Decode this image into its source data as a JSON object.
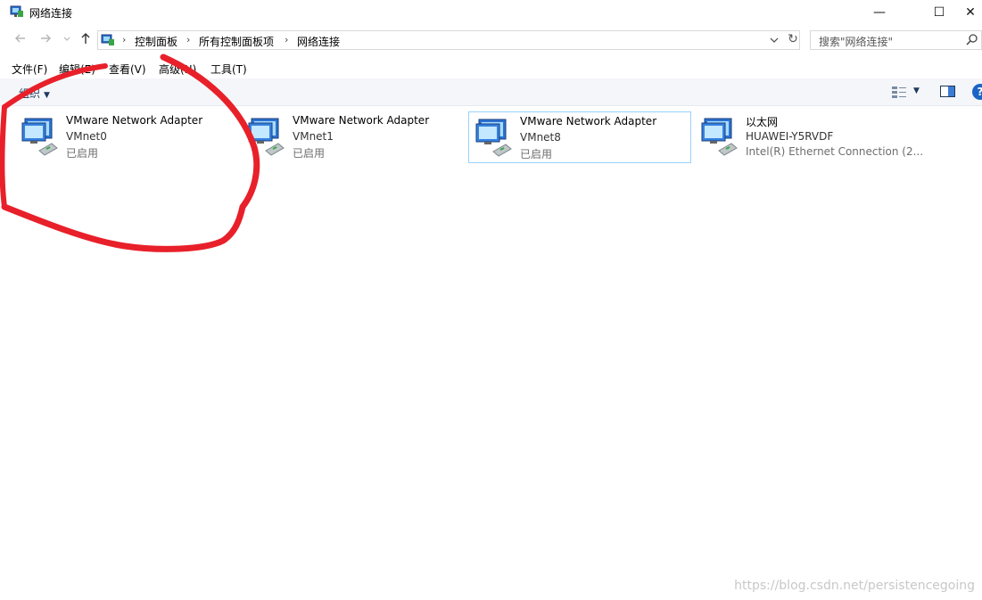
{
  "window": {
    "title": "网络连接",
    "controls": {
      "minimize": "—",
      "maximize": "☐",
      "close": "✕"
    }
  },
  "navigation": {
    "back_icon": "arrow-left-icon",
    "forward_icon": "arrow-right-icon",
    "recent_icon": "chevron-down-icon",
    "up_icon": "arrow-up-icon",
    "breadcrumbs": [
      "控制面板",
      "所有控制面板项",
      "网络连接"
    ],
    "separator": "›"
  },
  "search": {
    "placeholder": "搜索\"网络连接\""
  },
  "menu": {
    "items": [
      "文件(F)",
      "编辑(E)",
      "查看(V)",
      "高级(N)",
      "工具(T)"
    ]
  },
  "commandbar": {
    "organize": "组织"
  },
  "adapters": [
    {
      "name": "VMware Network Adapter",
      "network": "VMnet0",
      "status": "已启用",
      "selected": false
    },
    {
      "name": "VMware Network Adapter",
      "network": "VMnet1",
      "status": "已启用",
      "selected": false
    },
    {
      "name": "VMware Network Adapter",
      "network": "VMnet8",
      "status": "已启用",
      "selected": true
    },
    {
      "name": "以太网",
      "network": "HUAWEI-Y5RVDF",
      "status": "Intel(R) Ethernet Connection (2...",
      "selected": false
    }
  ],
  "watermark": "https://blog.csdn.net/persistencegoing",
  "colors": {
    "annotation": "#e8202a",
    "selection_border": "#99d1ff",
    "commandbar_bg": "#f4f6f9"
  }
}
